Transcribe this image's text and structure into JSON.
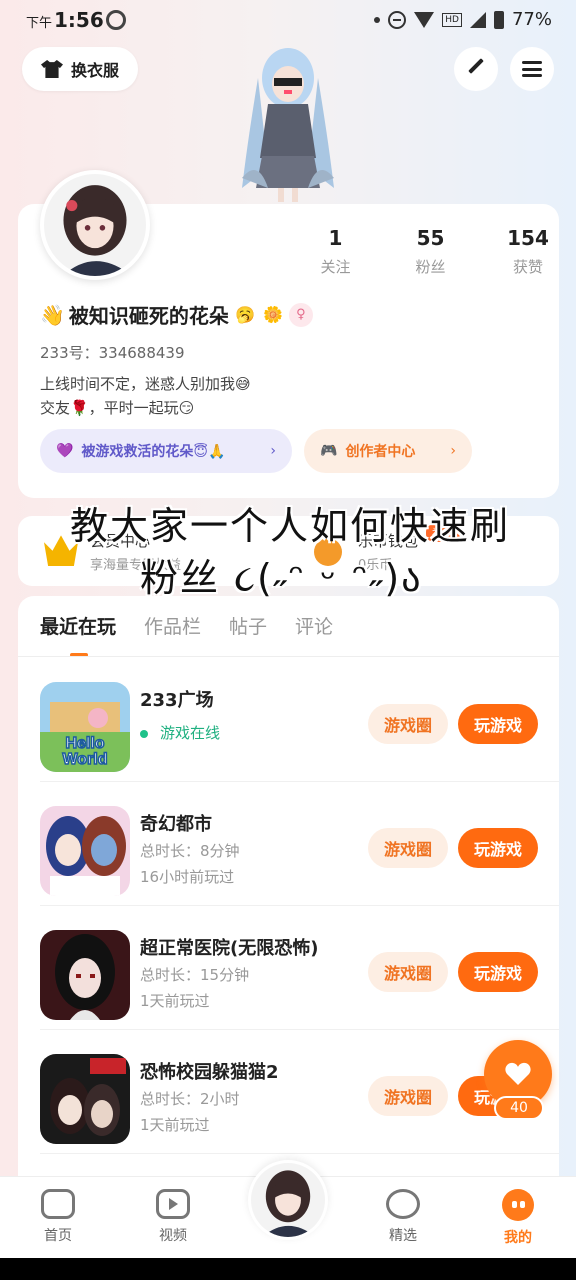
{
  "status_bar": {
    "ampm": "下午",
    "time": "1:56",
    "network": "HD",
    "battery": "77%"
  },
  "header": {
    "dress_label": "换衣服"
  },
  "profile": {
    "stats": [
      {
        "value": "1",
        "label": "关注"
      },
      {
        "value": "55",
        "label": "粉丝"
      },
      {
        "value": "154",
        "label": "获赞"
      }
    ],
    "nickname": "被知识砸死的花朵",
    "uid": "233号：334688439",
    "bio": "上线时间不定，迷惑人别加我😅\n交友🌹，平时一起玩😏",
    "tag_purple": "被游戏救活的花朵😇🙏",
    "tag_orange": "创作者中心"
  },
  "vip": {
    "title": "会员中心",
    "sub": "享海量专属权益",
    "coin_title": "乐币钱包",
    "coin_sub": "0乐币",
    "coin_badge": "福利"
  },
  "overlay": {
    "line1": "教大家一个人如何快速刷",
    "line2": "粉丝 ૮(˶ᵔ ᵕ ᵔ˶)ა"
  },
  "tabs": [
    "最近在玩",
    "作品栏",
    "帖子",
    "评论"
  ],
  "games": [
    {
      "name": "233广场",
      "meta1": "游戏在线",
      "meta2": "",
      "online": true
    },
    {
      "name": "奇幻都市",
      "meta1": "总时长：8分钟",
      "meta2": "16小时前玩过",
      "online": false
    },
    {
      "name": "超正常医院(无限恐怖)",
      "meta1": "总时长：15分钟",
      "meta2": "1天前玩过",
      "online": false
    },
    {
      "name": "恐怖校园躲猫猫2",
      "meta1": "总时长：2小时",
      "meta2": "1天前玩过",
      "online": false
    }
  ],
  "game_buttons": {
    "circle": "游戏圈",
    "play": "玩游戏"
  },
  "fab": {
    "count": "40"
  },
  "nav": [
    {
      "label": "首页"
    },
    {
      "label": "视频"
    },
    {
      "label": "精选"
    },
    {
      "label": "我的"
    }
  ],
  "colors": {
    "accent": "#ff7a1a",
    "purple": "#6059c9",
    "online": "#1fb080"
  }
}
